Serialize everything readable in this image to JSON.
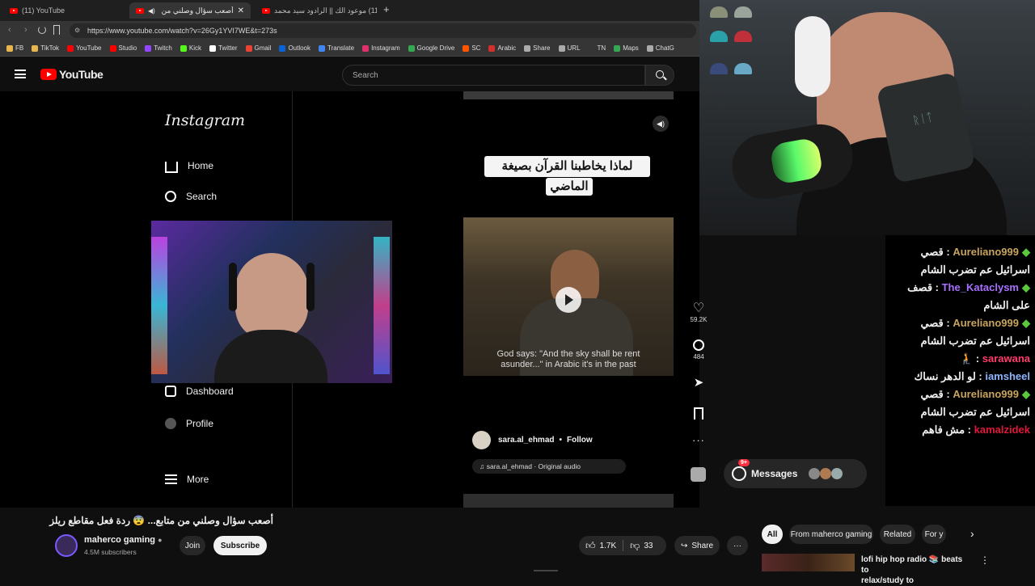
{
  "browser": {
    "tabs": [
      {
        "title": "(11) YouTube"
      },
      {
        "title": "أصعب سؤال وصلني من (11)"
      },
      {
        "title": "(11) موعود الك || الرادود سيد محمد"
      }
    ],
    "new_tab_glyph": "+",
    "url": "https://www.youtube.com/watch?v=26Gy1YVI7WE&t=273s",
    "bookmarks": [
      {
        "label": "FB",
        "color": "#e8b64c"
      },
      {
        "label": "TikTok",
        "color": "#e8b64c"
      },
      {
        "label": "YouTube",
        "color": "#ff0000"
      },
      {
        "label": "Studio",
        "color": "#ff0000"
      },
      {
        "label": "Twitch",
        "color": "#9146ff"
      },
      {
        "label": "Kick",
        "color": "#53fc18"
      },
      {
        "label": "Twitter",
        "color": "#ffffff"
      },
      {
        "label": "Gmail",
        "color": "#ea4335"
      },
      {
        "label": "Outlook",
        "color": "#0a64d8"
      },
      {
        "label": "Translate",
        "color": "#4285f4"
      },
      {
        "label": "Instagram",
        "color": "#e1306c"
      },
      {
        "label": "Google Drive",
        "color": "#34a853"
      },
      {
        "label": "SC",
        "color": "#ff5500"
      },
      {
        "label": "Arabic",
        "color": "#d32f2f"
      },
      {
        "label": "Share",
        "color": "#aaaaaa"
      },
      {
        "label": "URL",
        "color": "#aaaaaa"
      },
      {
        "label": "TN",
        "color": "#353535"
      },
      {
        "label": "Maps",
        "color": "#34a853"
      },
      {
        "label": "ChatG",
        "color": "#aaaaaa"
      }
    ]
  },
  "youtube": {
    "logo_text": "YouTube",
    "search_placeholder": "Search",
    "video_title": "أصعب سؤال وصلني من متابع... 😨 ردة فعل مقاطع ريلز",
    "channel_name": "maherco gaming",
    "subscribers": "4.5M subscribers",
    "join_label": "Join",
    "subscribe_label": "Subscribe",
    "likes": "1.7K",
    "dislikes": "33",
    "share_label": "Share",
    "filter_chips": [
      "All",
      "From maherco gaming",
      "Related",
      "For y"
    ],
    "suggested_title_line1": "lofi hip hop radio 📚 beats to",
    "suggested_title_line2": "relax/study to"
  },
  "instagram": {
    "logo": "Instagram",
    "nav": [
      {
        "label": "Home",
        "icon": "home-icon"
      },
      {
        "label": "Search",
        "icon": "search-icon"
      },
      {
        "label": "Dashboard",
        "icon": "dashboard-icon"
      },
      {
        "label": "Profile",
        "icon": "profile-icon"
      },
      {
        "label": "More",
        "icon": "menu-icon"
      }
    ],
    "reel_caption_line1": "لماذا يخاطبنا القرآن بصيغة",
    "reel_caption_line2": "الماضي",
    "subtitle_line1": "God says: \"And the sky shall be rent",
    "subtitle_line2": "asunder...\" in Arabic it's in the past",
    "likes": "59.2K",
    "comments": "484",
    "author": "sara.al_ehmad",
    "follow_label": "Follow",
    "separator": "•",
    "audio": "sara.al_ehmad · Original audio",
    "messages_label": "Messages",
    "messages_badge": "9+"
  },
  "chat": [
    {
      "user": "Aureliano999",
      "color": "#c9a45c",
      "text": "قصي",
      "line2": "اسرائيل عم تضرب الشام",
      "badge": true
    },
    {
      "user": "The_Kataclysm",
      "color": "#a970ff",
      "text": "قصف",
      "line2": "على الشام",
      "badge": true
    },
    {
      "user": "Aureliano999",
      "color": "#c9a45c",
      "text": "قصي",
      "line2": "اسرائيل عم تضرب الشام",
      "badge": true
    },
    {
      "user": "sarawana",
      "color": "#ff3b6b",
      "text": "🧎",
      "line2": "",
      "badge": false
    },
    {
      "user": "iamsheel",
      "color": "#8fb5ff",
      "text": "لو الدهر نساك",
      "line2": "",
      "badge": false
    },
    {
      "user": "Aureliano999",
      "color": "#c9a45c",
      "text": "قصي",
      "line2": "اسرائيل عم تضرب الشام",
      "badge": true
    },
    {
      "user": "kamalzidek",
      "color": "#e0163a",
      "text": "مش فاهم",
      "line2": "",
      "badge": false
    }
  ]
}
